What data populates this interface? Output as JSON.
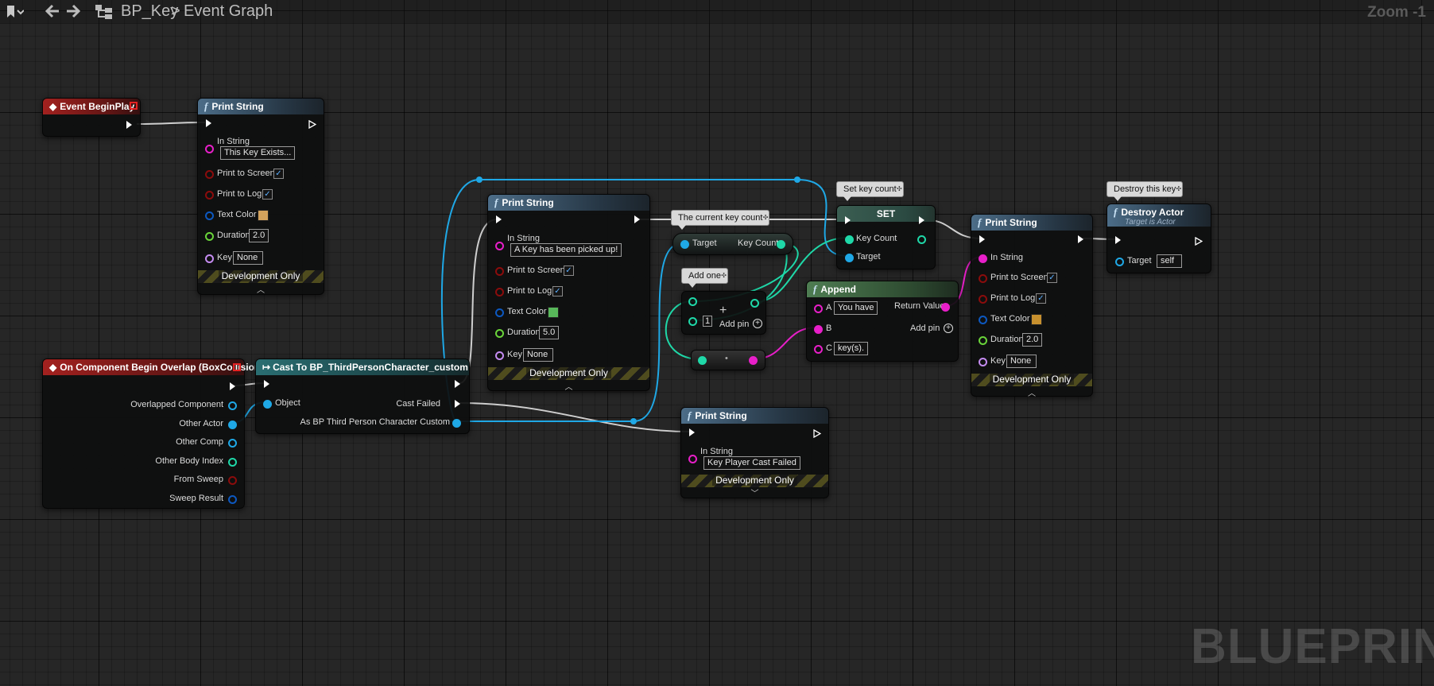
{
  "toolbar": {
    "breadcrumb_blueprint": "BP_Key",
    "breadcrumb_separator": ">",
    "breadcrumb_graph": "Event Graph",
    "zoom": "Zoom -1"
  },
  "watermark": "BLUEPRINT",
  "nodes": {
    "begin_play": {
      "title": "Event BeginPlay"
    },
    "print1": {
      "title": "Print String",
      "in_string_label": "In String",
      "in_string_value": "This Key Exists...",
      "print_screen_label": "Print to Screen",
      "print_log_label": "Print to Log",
      "text_color_label": "Text Color",
      "text_color": "#d3a25c",
      "duration_label": "Duration",
      "duration_value": "2.0",
      "key_label": "Key",
      "key_value": "None",
      "dev_label": "Development Only",
      "checked": "✓"
    },
    "overlap": {
      "title": "On Component Begin Overlap (BoxCollision)",
      "pins": [
        "Overlapped Component",
        "Other Actor",
        "Other Comp",
        "Other Body Index",
        "From Sweep",
        "Sweep Result"
      ]
    },
    "cast": {
      "title": "Cast To BP_ThirdPersonCharacter_custom",
      "object_label": "Object",
      "cast_failed_label": "Cast Failed",
      "as_label": "As BP Third Person Character Custom"
    },
    "print2": {
      "title": "Print String",
      "in_string_label": "In String",
      "in_string_value": "A Key has been picked up!",
      "print_screen_label": "Print to Screen",
      "print_log_label": "Print to Log",
      "text_color_label": "Text Color",
      "text_color": "#58b85a",
      "duration_label": "Duration",
      "duration_value": "5.0",
      "key_label": "Key",
      "key_value": "None",
      "dev_label": "Development Only",
      "checked": "✓"
    },
    "key_count_getter": {
      "target_label": "Target",
      "key_count_label": "Key Count"
    },
    "add_node": {
      "value": "1",
      "add_pin_label": "Add pin",
      "plus": "+"
    },
    "reroute": {
      "dot": "•"
    },
    "set_node": {
      "title": "SET",
      "key_count_label": "Key Count",
      "target_label": "Target"
    },
    "append": {
      "title": "Append",
      "a_label": "A",
      "a_value": "You have",
      "b_label": "B",
      "c_label": "C",
      "c_value": "key(s).",
      "return_label": "Return Value",
      "add_pin_label": "Add pin"
    },
    "print3": {
      "title": "Print String",
      "in_string_label": "In String",
      "print_screen_label": "Print to Screen",
      "print_log_label": "Print to Log",
      "text_color_label": "Text Color",
      "text_color": "#c7902e",
      "duration_label": "Duration",
      "duration_value": "2.0",
      "key_label": "Key",
      "key_value": "None",
      "dev_label": "Development Only",
      "checked": "✓"
    },
    "destroy": {
      "title": "Destroy Actor",
      "subtitle": "Target is Actor",
      "target_label": "Target",
      "target_value": "self"
    },
    "print4": {
      "title": "Print String",
      "in_string_label": "In String",
      "in_string_value": "Key Player Cast Failed",
      "dev_label": "Development Only"
    }
  },
  "comments": {
    "current_key_count": "The current key count",
    "add_one": "Add one",
    "set_key_count": "Set key count",
    "destroy_this_key": "Destroy this key"
  },
  "colors": {
    "exec": "#ffffff",
    "object": "#1fa8e6",
    "string": "#e81fc9",
    "bool": "#8b0c0c",
    "struct": "#0d58c0",
    "float": "#6ad43a",
    "name": "#c58cf1",
    "integer": "#1fd8a8",
    "event_header": "#a3211f",
    "function_header": "#4c6d88"
  }
}
